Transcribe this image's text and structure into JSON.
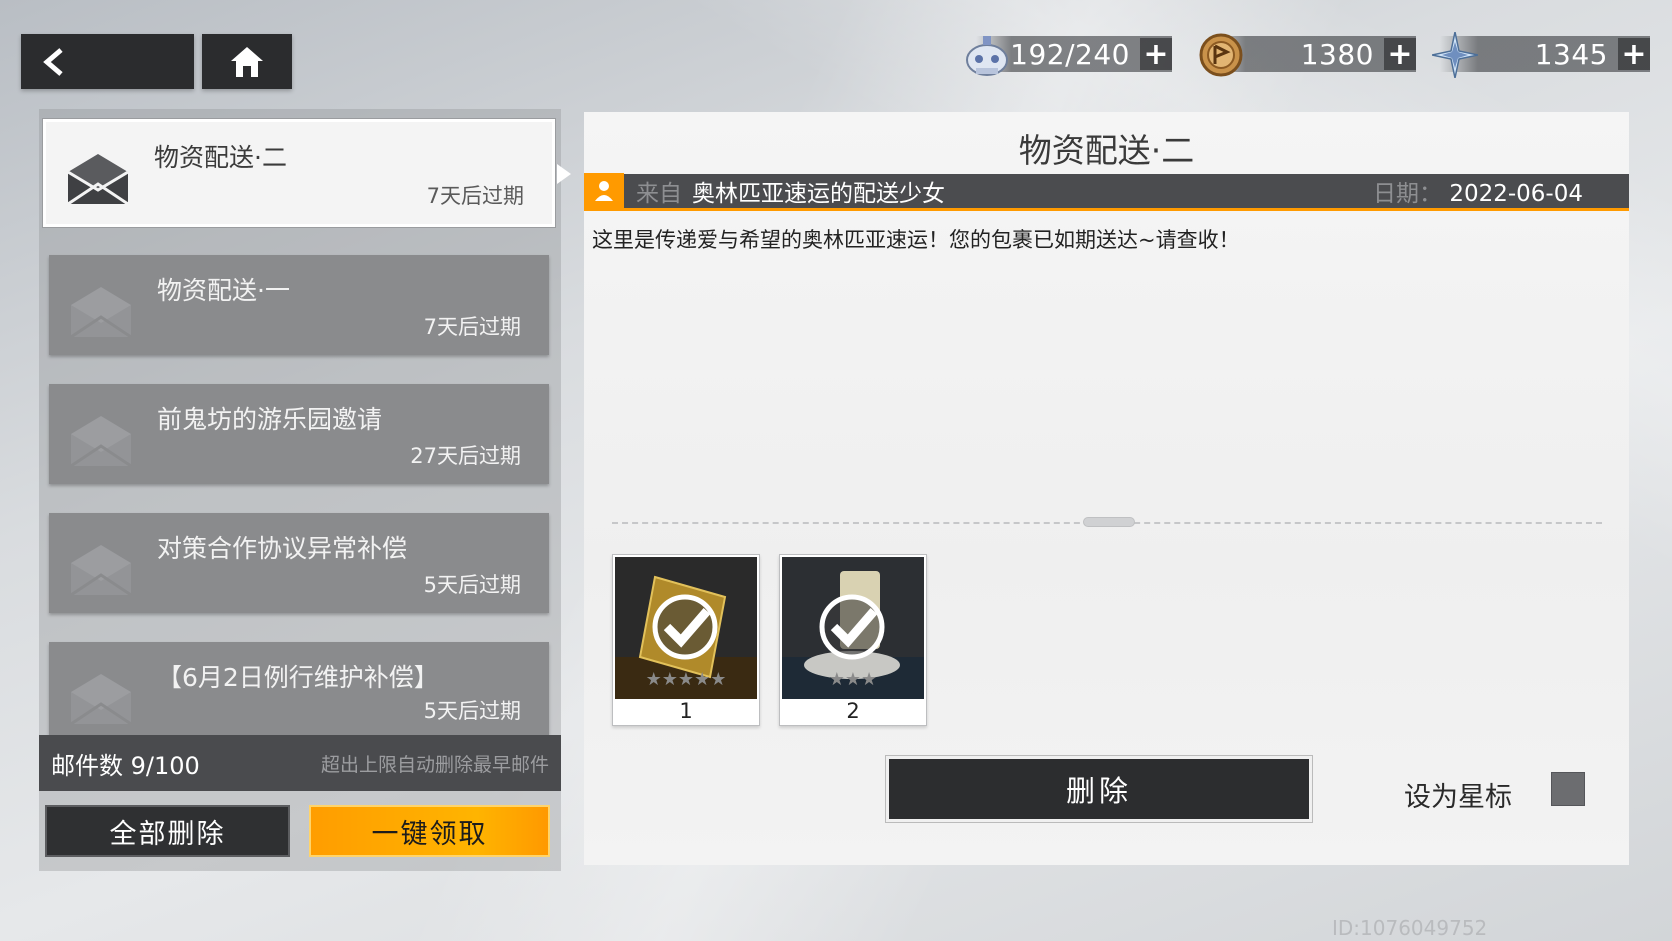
{
  "header": {
    "resources": [
      {
        "name": "stamina",
        "icon": "robot-stamina-icon",
        "value": "192/240"
      },
      {
        "name": "coin",
        "icon": "coin-icon",
        "value": "1380"
      },
      {
        "name": "crystal",
        "icon": "star-crystal-icon",
        "value": "1345"
      }
    ],
    "plus": "+"
  },
  "mail_list": {
    "items": [
      {
        "title": "物资配送·二",
        "expire": "7天后过期",
        "selected": true
      },
      {
        "title": "物资配送·一",
        "expire": "7天后过期"
      },
      {
        "title": "前鬼坊的游乐园邀请",
        "expire": "27天后过期"
      },
      {
        "title": "对策合作协议异常补偿",
        "expire": "5天后过期"
      },
      {
        "title": "【6月2日例行维护补偿】",
        "expire": "5天后过期"
      }
    ],
    "count": "邮件数 9/100",
    "hint": "超出上限自动删除最早邮件",
    "delete_all": "全部删除",
    "claim_all": "一键领取"
  },
  "detail": {
    "title": "物资配送·二",
    "from_label": "来自",
    "sender": "奥林匹亚速运的配送少女",
    "date_label": "日期：",
    "date": "2022-06-04",
    "body": "这里是传递爱与希望的奥林匹亚速运！您的包裹已如期送达~请查收！",
    "attachments": [
      {
        "qty": "1",
        "stars": 5,
        "claimed": true
      },
      {
        "qty": "2",
        "stars": 3,
        "claimed": true
      }
    ],
    "delete_button": "删除",
    "star_label": "设为星标"
  },
  "footer": {
    "uid": "ID:1076049752"
  },
  "colors": {
    "accent": "#ff9a00",
    "dark_panel": "#2c2d2f"
  }
}
